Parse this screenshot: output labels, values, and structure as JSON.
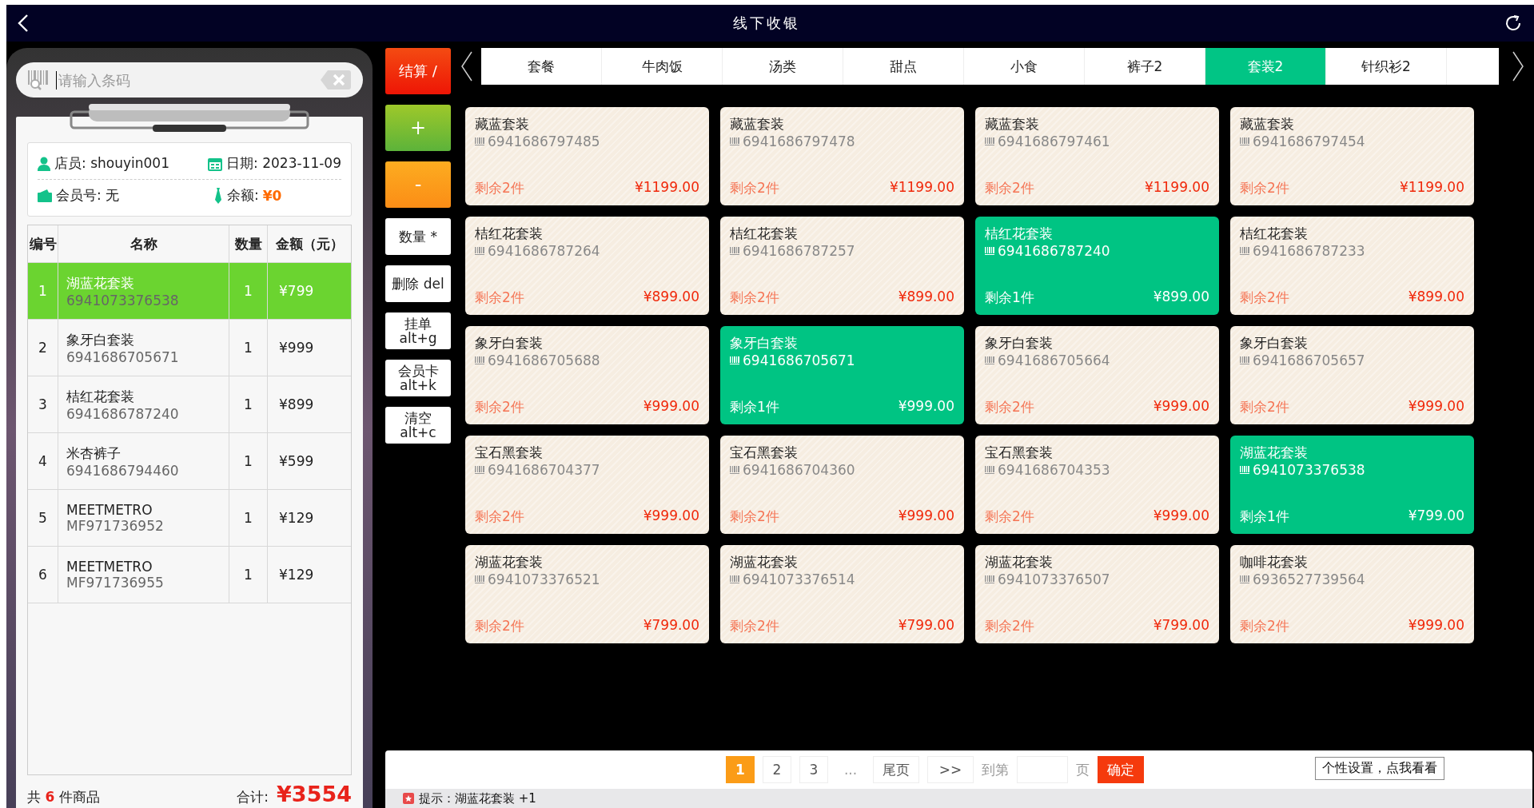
{
  "title_bar": {
    "title": "线下收银"
  },
  "search": {
    "placeholder": "请输入条码"
  },
  "info": {
    "clerk": "店员: shouyin001",
    "date": "日期: 2023-11-09",
    "member": "会员号: 无",
    "balance_label": "余额:",
    "balance": "¥0"
  },
  "cart": {
    "columns": [
      "编号",
      "名称",
      "数量",
      "金额（元）"
    ],
    "rows": [
      {
        "no": "1",
        "name": "湖蓝花套装",
        "code": "6941073376538",
        "qty": "1",
        "amount": "¥799",
        "selected": true
      },
      {
        "no": "2",
        "name": "象牙白套装",
        "code": "6941686705671",
        "qty": "1",
        "amount": "¥999",
        "selected": false
      },
      {
        "no": "3",
        "name": "桔红花套装",
        "code": "6941686787240",
        "qty": "1",
        "amount": "¥899",
        "selected": false
      },
      {
        "no": "4",
        "name": "米杏裤子",
        "code": "6941686794460",
        "qty": "1",
        "amount": "¥599",
        "selected": false
      },
      {
        "no": "5",
        "name": "MEETMETRO",
        "code": "MF971736952",
        "qty": "1",
        "amount": "¥129",
        "selected": false
      },
      {
        "no": "6",
        "name": "MEETMETRO",
        "code": "MF971736955",
        "qty": "1",
        "amount": "¥129",
        "selected": false
      }
    ]
  },
  "summary": {
    "count_prefix": "共",
    "count": "6",
    "count_suffix": "件商品",
    "total_label": "合计:",
    "total": "¥3554"
  },
  "actions": [
    {
      "lines": [
        "结算 /"
      ],
      "kind": "checkout"
    },
    {
      "lines": [
        "+"
      ],
      "kind": "plus"
    },
    {
      "lines": [
        "-"
      ],
      "kind": "minus"
    },
    {
      "lines": [
        "数量 *"
      ],
      "kind": "plain"
    },
    {
      "lines": [
        "删除 del"
      ],
      "kind": "plain"
    },
    {
      "lines": [
        "挂单",
        "alt+g"
      ],
      "kind": "plain"
    },
    {
      "lines": [
        "会员卡",
        "alt+k"
      ],
      "kind": "plain"
    },
    {
      "lines": [
        "清空",
        "alt+c"
      ],
      "kind": "plain"
    }
  ],
  "categories": [
    {
      "label": "套餐",
      "selected": false
    },
    {
      "label": "牛肉饭",
      "selected": false
    },
    {
      "label": "汤类",
      "selected": false
    },
    {
      "label": "甜点",
      "selected": false
    },
    {
      "label": "小食",
      "selected": false
    },
    {
      "label": "裤子2",
      "selected": false
    },
    {
      "label": "套装2",
      "selected": true
    },
    {
      "label": "针织衫2",
      "selected": false
    }
  ],
  "products": [
    {
      "name": "藏蓝套装",
      "code": "6941686797485",
      "stock": "剩余2件",
      "price": "¥1199.00",
      "selected": false
    },
    {
      "name": "藏蓝套装",
      "code": "6941686797478",
      "stock": "剩余2件",
      "price": "¥1199.00",
      "selected": false
    },
    {
      "name": "藏蓝套装",
      "code": "6941686797461",
      "stock": "剩余2件",
      "price": "¥1199.00",
      "selected": false
    },
    {
      "name": "藏蓝套装",
      "code": "6941686797454",
      "stock": "剩余2件",
      "price": "¥1199.00",
      "selected": false
    },
    {
      "name": "桔红花套装",
      "code": "6941686787264",
      "stock": "剩余2件",
      "price": "¥899.00",
      "selected": false
    },
    {
      "name": "桔红花套装",
      "code": "6941686787257",
      "stock": "剩余2件",
      "price": "¥899.00",
      "selected": false
    },
    {
      "name": "桔红花套装",
      "code": "6941686787240",
      "stock": "剩余1件",
      "price": "¥899.00",
      "selected": true
    },
    {
      "name": "桔红花套装",
      "code": "6941686787233",
      "stock": "剩余2件",
      "price": "¥899.00",
      "selected": false
    },
    {
      "name": "象牙白套装",
      "code": "6941686705688",
      "stock": "剩余2件",
      "price": "¥999.00",
      "selected": false
    },
    {
      "name": "象牙白套装",
      "code": "6941686705671",
      "stock": "剩余1件",
      "price": "¥999.00",
      "selected": true
    },
    {
      "name": "象牙白套装",
      "code": "6941686705664",
      "stock": "剩余2件",
      "price": "¥999.00",
      "selected": false
    },
    {
      "name": "象牙白套装",
      "code": "6941686705657",
      "stock": "剩余2件",
      "price": "¥999.00",
      "selected": false
    },
    {
      "name": "宝石黑套装",
      "code": "6941686704377",
      "stock": "剩余2件",
      "price": "¥999.00",
      "selected": false
    },
    {
      "name": "宝石黑套装",
      "code": "6941686704360",
      "stock": "剩余2件",
      "price": "¥999.00",
      "selected": false
    },
    {
      "name": "宝石黑套装",
      "code": "6941686704353",
      "stock": "剩余2件",
      "price": "¥999.00",
      "selected": false
    },
    {
      "name": "湖蓝花套装",
      "code": "6941073376538",
      "stock": "剩余1件",
      "price": "¥799.00",
      "selected": true
    },
    {
      "name": "湖蓝花套装",
      "code": "6941073376521",
      "stock": "剩余2件",
      "price": "¥799.00",
      "selected": false
    },
    {
      "name": "湖蓝花套装",
      "code": "6941073376514",
      "stock": "剩余2件",
      "price": "¥799.00",
      "selected": false
    },
    {
      "name": "湖蓝花套装",
      "code": "6941073376507",
      "stock": "剩余2件",
      "price": "¥799.00",
      "selected": false
    },
    {
      "name": "咖啡花套装",
      "code": "6936527739564",
      "stock": "剩余2件",
      "price": "¥999.00",
      "selected": false
    }
  ],
  "pagination": {
    "pages": [
      {
        "label": "1",
        "selected": true
      },
      {
        "label": "2",
        "selected": false
      },
      {
        "label": "3",
        "selected": false
      }
    ],
    "ellipsis": "...",
    "last": "尾页",
    "next": ">>",
    "goto_label": "到第",
    "page_suffix": "页",
    "confirm": "确定"
  },
  "tooltip": "个性设置，点我看看",
  "status_bar": {
    "message": "提示：湖蓝花套装 +1"
  }
}
